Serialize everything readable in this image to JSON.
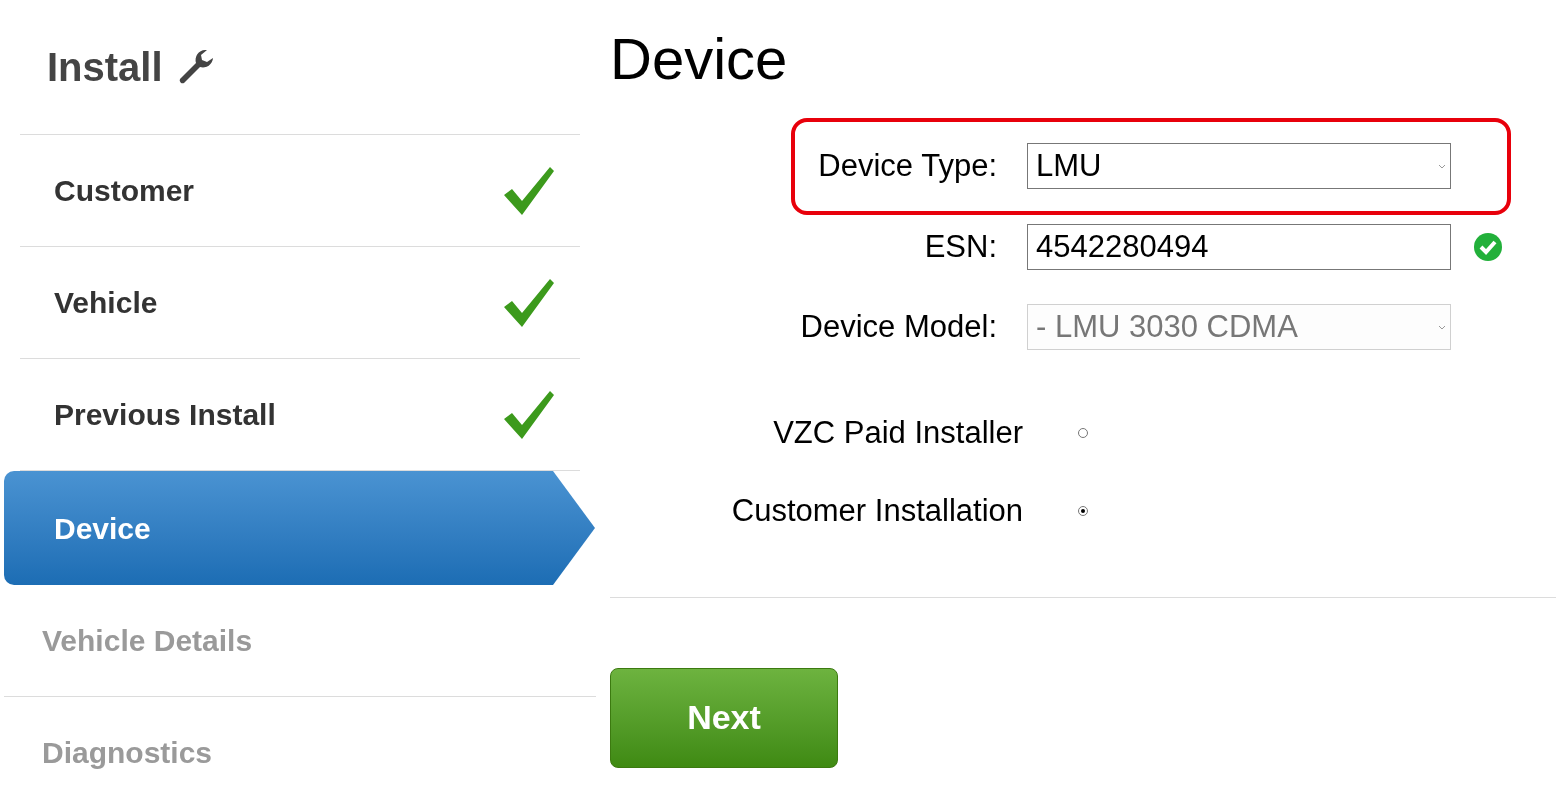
{
  "sidebar": {
    "title": "Install",
    "steps": [
      {
        "label": "Customer",
        "completed": true,
        "selected": false
      },
      {
        "label": "Vehicle",
        "completed": true,
        "selected": false
      },
      {
        "label": "Previous Install",
        "completed": true,
        "selected": false
      },
      {
        "label": "Device",
        "completed": false,
        "selected": true
      },
      {
        "label": "Vehicle Details",
        "completed": false,
        "selected": false
      },
      {
        "label": "Diagnostics",
        "completed": false,
        "selected": false
      }
    ]
  },
  "page": {
    "title": "Device",
    "fields": [
      {
        "kind": "select",
        "label": "Device Type:",
        "value": "LMU",
        "highlighted": true,
        "valid": false,
        "disabled": false
      },
      {
        "kind": "text",
        "label": "ESN:",
        "value": "4542280494",
        "highlighted": false,
        "valid": true,
        "disabled": false
      },
      {
        "kind": "select",
        "label": "Device Model:",
        "value": "- LMU 3030 CDMA",
        "highlighted": false,
        "valid": false,
        "disabled": true
      }
    ],
    "installer": [
      {
        "label": "VZC Paid Installer",
        "selected": false
      },
      {
        "label": "Customer Installation",
        "selected": true
      }
    ],
    "next_button": "Next"
  }
}
